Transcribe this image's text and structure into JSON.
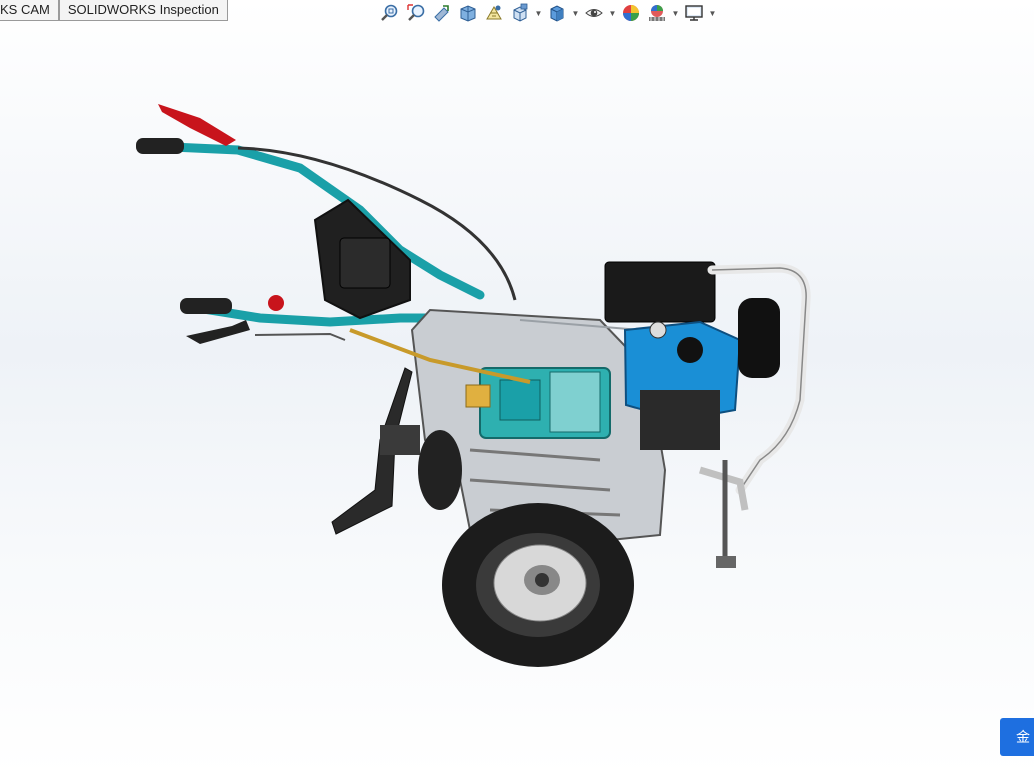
{
  "tabs": [
    {
      "label": "KS CAM"
    },
    {
      "label": "SOLIDWORKS Inspection"
    }
  ],
  "heads_up_toolbar": [
    {
      "icon": "zoom-to-fit-icon"
    },
    {
      "icon": "zoom-to-area-icon"
    },
    {
      "icon": "previous-view-icon"
    },
    {
      "icon": "section-view-icon"
    },
    {
      "icon": "dynamic-annotation-views-icon"
    },
    {
      "icon": "view-orientation-icon",
      "dropdown": true
    },
    {
      "icon": "display-style-icon",
      "dropdown": true
    },
    {
      "icon": "hide-show-items-icon",
      "dropdown": true
    },
    {
      "icon": "edit-appearance-icon"
    },
    {
      "icon": "apply-scene-icon",
      "dropdown": true
    },
    {
      "icon": "view-settings-icon",
      "dropdown": true
    }
  ],
  "corner_widget": {
    "label": "金"
  },
  "colors": {
    "handlebar": "#1aa0a8",
    "engine_blue": "#1a8fd6",
    "steel": "#c9cdd2",
    "tyre": "#1c1c1c",
    "lever_red": "#c8141c",
    "corner_blue": "#1e6fe0"
  }
}
